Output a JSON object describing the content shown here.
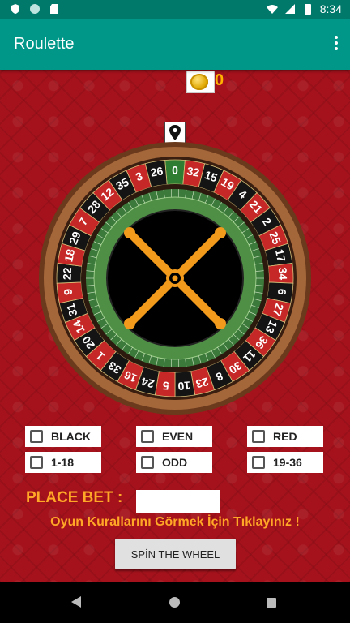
{
  "status": {
    "time": "8:34",
    "left_icons": [
      "shield-icon",
      "circle-icon",
      "sd-card-icon"
    ],
    "right_icons": [
      "wifi-icon",
      "signal-icon",
      "battery-icon"
    ]
  },
  "app": {
    "title": "Roulette",
    "menu_icon": "more-vert-icon"
  },
  "balance": {
    "coins": "0",
    "icon": "coin-icon"
  },
  "wheel": {
    "pointer_icon": "location-pin-icon",
    "numbers": [
      "0",
      "32",
      "15",
      "19",
      "4",
      "21",
      "2",
      "25",
      "17",
      "34",
      "6",
      "27",
      "13",
      "36",
      "11",
      "30",
      "8",
      "23",
      "10",
      "5",
      "24",
      "16",
      "33",
      "1",
      "20",
      "14",
      "31",
      "9",
      "22",
      "18",
      "29",
      "7",
      "28",
      "12",
      "35",
      "3",
      "26"
    ],
    "colors": {
      "red": "#c62828",
      "black": "#141414",
      "green": "#2e7d32",
      "rim": "#a4673a",
      "felt": "#3c7a3c",
      "hub": "#000000",
      "turret": "#f29a1b"
    }
  },
  "bets": {
    "row1": [
      {
        "label": "BLACK"
      },
      {
        "label": "EVEN"
      },
      {
        "label": "RED"
      }
    ],
    "row2": [
      {
        "label": "1-18"
      },
      {
        "label": "ODD"
      },
      {
        "label": "19-36"
      }
    ]
  },
  "place_bet_label": "PLACE BET :",
  "bet_value": "",
  "rules_link": "Oyun Kurallarını Görmek İçin Tıklayınız !",
  "spin_button": "SPİN THE WHEEL"
}
